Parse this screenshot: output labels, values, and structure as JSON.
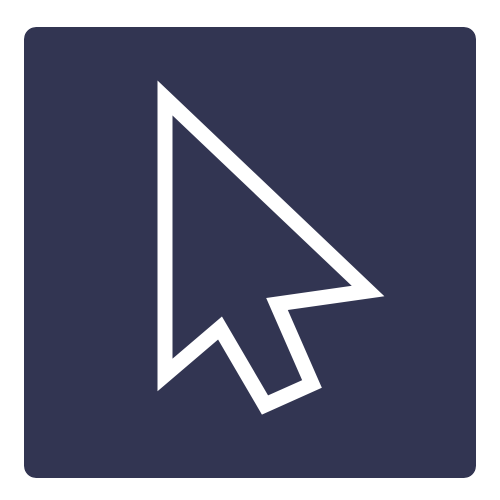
{
  "icon": {
    "name": "mouse-pointer-icon",
    "background_color": "#323552",
    "stroke_color": "#ffffff",
    "fill_color": "#323552"
  }
}
